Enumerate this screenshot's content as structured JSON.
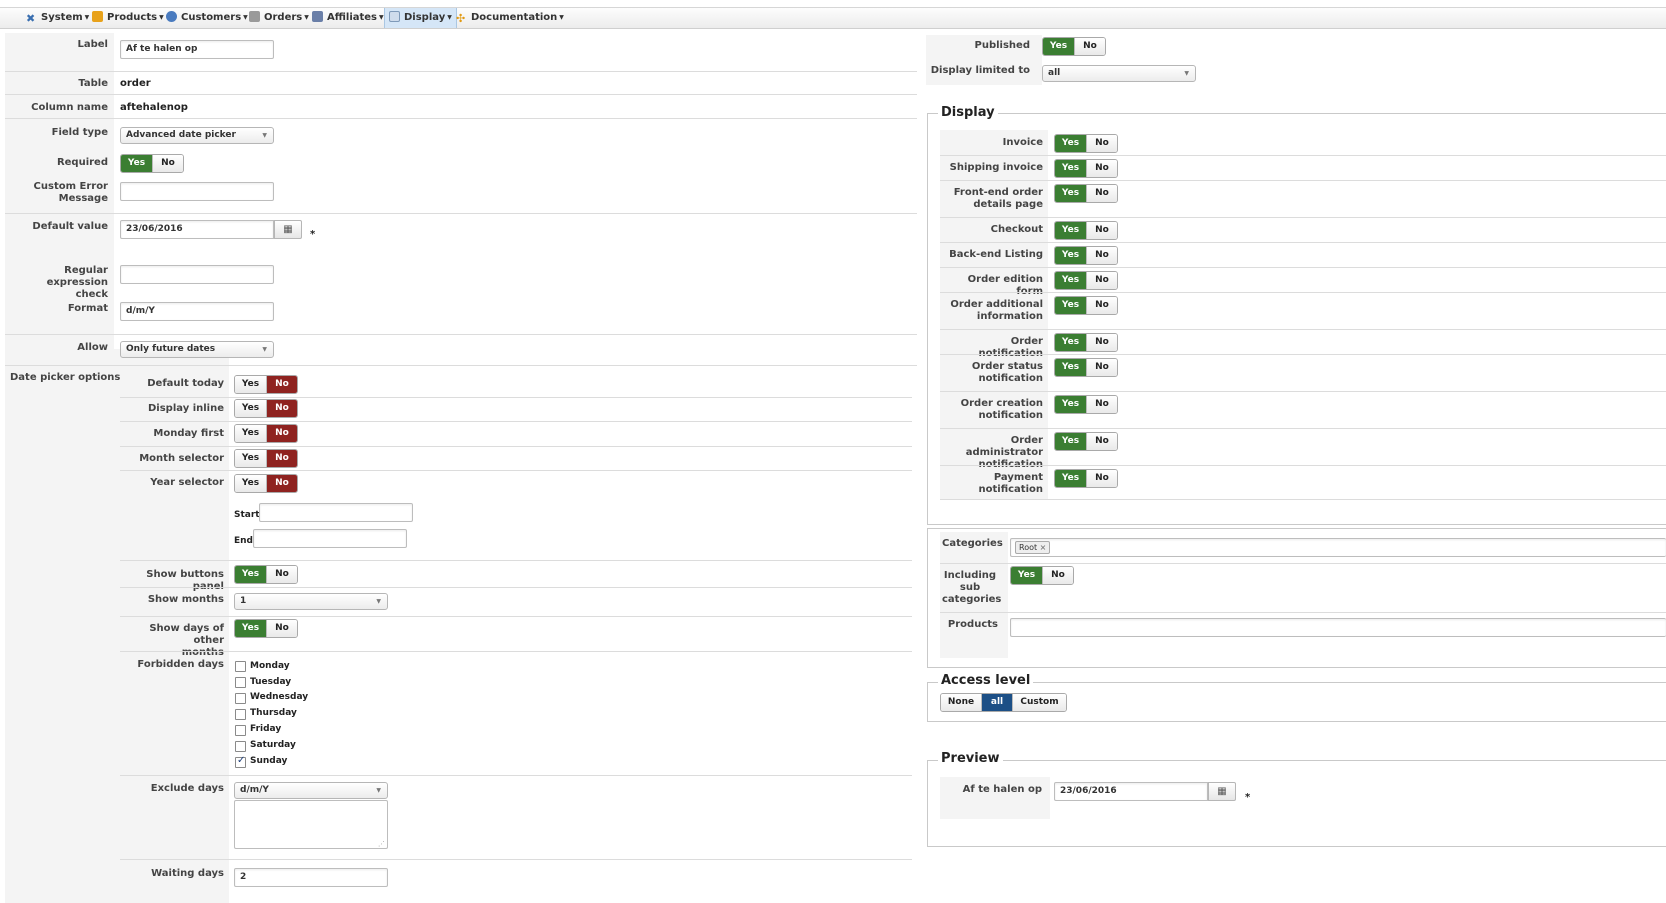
{
  "menu": {
    "items": [
      {
        "label": "System",
        "icon": "tools-icon"
      },
      {
        "label": "Products",
        "icon": "box-icon"
      },
      {
        "label": "Customers",
        "icon": "users-icon"
      },
      {
        "label": "Orders",
        "icon": "cart-icon"
      },
      {
        "label": "Affiliates",
        "icon": "affiliate-icon"
      },
      {
        "label": "Display",
        "icon": "display-icon",
        "active": true
      },
      {
        "label": "Documentation",
        "icon": "help-icon"
      }
    ]
  },
  "left": {
    "label": {
      "label": "Label",
      "value": "Af te halen op"
    },
    "table": {
      "label": "Table",
      "value": "order"
    },
    "column": {
      "label": "Column name",
      "value": "aftehalenop"
    },
    "field_type": {
      "label": "Field type",
      "value": "Advanced date picker"
    },
    "required": {
      "label": "Required",
      "yes": "Yes",
      "no": "No"
    },
    "custom_error": {
      "label1": "Custom Error",
      "label2": "Message",
      "value": ""
    },
    "default_value": {
      "label": "Default value",
      "value": "23/06/2016",
      "star": "*"
    },
    "regex": {
      "label1": "Regular expression",
      "label2": "check",
      "value": ""
    },
    "format": {
      "label": "Format",
      "value": "d/m/Y"
    },
    "allow": {
      "label": "Allow",
      "value": "Only future dates"
    },
    "dp_label": "Date picker options",
    "dp": {
      "default_today": "Default today",
      "display_inline": "Display inline",
      "monday_first": "Monday first",
      "month_selector": "Month selector",
      "year_selector": "Year selector",
      "start": "Start",
      "end": "End",
      "show_buttons": "Show buttons panel",
      "show_months": "Show months",
      "show_months_value": "1",
      "show_other1": "Show days of other",
      "show_other2": "months",
      "forbidden": "Forbidden days",
      "days": [
        "Monday",
        "Tuesday",
        "Wednesday",
        "Thursday",
        "Friday",
        "Saturday",
        "Sunday"
      ],
      "exclude": "Exclude days",
      "exclude_format": "d/m/Y",
      "waiting": "Waiting days",
      "waiting_value": "2"
    },
    "yes": "Yes",
    "no": "No"
  },
  "right": {
    "published": "Published",
    "display_limited": "Display limited to",
    "display_limited_value": "all",
    "display_legend": "Display",
    "display_rows": [
      {
        "l1": "Invoice",
        "l2": ""
      },
      {
        "l1": "Shipping invoice",
        "l2": ""
      },
      {
        "l1": "Front-end order",
        "l2": "details page"
      },
      {
        "l1": "Checkout",
        "l2": ""
      },
      {
        "l1": "Back-end Listing",
        "l2": ""
      },
      {
        "l1": "Order edition form",
        "l2": ""
      },
      {
        "l1": "Order additional",
        "l2": "information"
      },
      {
        "l1": "Order notification",
        "l2": ""
      },
      {
        "l1": "Order status",
        "l2": "notification"
      },
      {
        "l1": "Order creation",
        "l2": "notification"
      },
      {
        "l1": "Order administrator",
        "l2": "notification"
      },
      {
        "l1": "Payment",
        "l2": "notification"
      }
    ],
    "categories": "Categories",
    "category_tag": "Root",
    "including1": "Including",
    "including2": "sub",
    "including3": "categories",
    "products": "Products",
    "access_legend": "Access level",
    "access": {
      "none": "None",
      "all": "all",
      "custom": "Custom"
    },
    "preview_legend": "Preview",
    "preview_label": "Af te halen op",
    "preview_value": "23/06/2016",
    "preview_star": "*"
  },
  "colors": {
    "yes_green": "#3b7e32",
    "no_red": "#8f2320",
    "selected_blue": "#1c4f86"
  }
}
